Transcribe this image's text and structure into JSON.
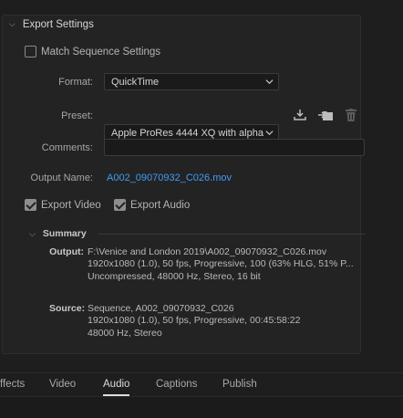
{
  "section": {
    "title": "Export Settings"
  },
  "match_sequence": {
    "label": "Match Sequence Settings",
    "checked": false
  },
  "format": {
    "label": "Format:",
    "value": "QuickTime"
  },
  "preset": {
    "label": "Preset:",
    "value": "Apple ProRes 4444 XQ with alpha"
  },
  "comments": {
    "label": "Comments:",
    "value": ""
  },
  "output_name": {
    "label": "Output Name:",
    "value": "A002_09070932_C026.mov"
  },
  "export_video": {
    "label": "Export Video",
    "checked": true
  },
  "export_audio": {
    "label": "Export Audio",
    "checked": true
  },
  "summary": {
    "title": "Summary",
    "output_label": "Output:",
    "output_lines": [
      "F:\\Venice and London 2019\\A002_09070932_C026.mov",
      "1920x1080 (1.0), 50 fps, Progressive, 100 (63% HLG, 51% P...",
      "Uncompressed, 48000 Hz, Stereo, 16 bit"
    ],
    "source_label": "Source:",
    "source_lines": [
      "Sequence, A002_09070932_C026",
      "1920x1080 (1.0), 50 fps, Progressive, 00:45:58:22",
      "48000 Hz, Stereo"
    ]
  },
  "tabs": [
    "ffects",
    "Video",
    "Audio",
    "Captions",
    "Publish"
  ],
  "active_tab": "Audio",
  "icons": {
    "section_toggle": "chevron-down-icon",
    "save_preset": "save-preset-icon",
    "import_preset": "import-preset-icon",
    "delete_preset": "trash-icon"
  },
  "colors": {
    "link": "#3f9df6",
    "panel": "#232323",
    "background": "#1e1e1e"
  }
}
